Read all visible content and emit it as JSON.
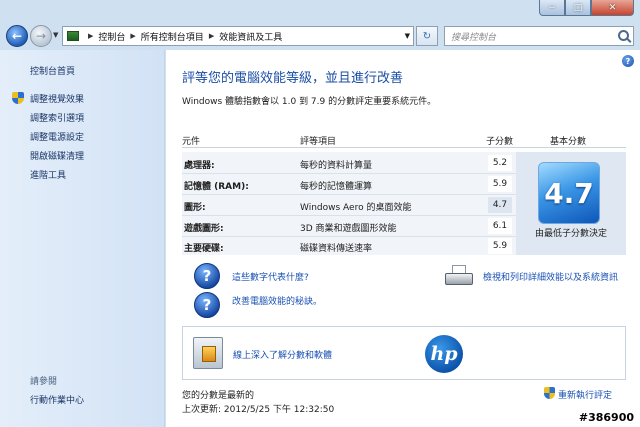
{
  "window": {
    "caption_minimize": "−",
    "caption_maximize": "□",
    "caption_close": "✕"
  },
  "nav": {
    "breadcrumb": [
      "控制台",
      "所有控制台項目",
      "效能資訊及工具"
    ],
    "search_placeholder": "搜尋控制台"
  },
  "sidebar": {
    "home": "控制台首頁",
    "links": [
      "調整視覺效果",
      "調整索引選項",
      "調整電源設定",
      "開啟磁碟清理",
      "進階工具"
    ],
    "see_also_header": "請參閱",
    "see_also": [
      "行動作業中心"
    ]
  },
  "main": {
    "title": "評等您的電腦效能等級，並且進行改善",
    "subtitle": "Windows 體驗指數會以 1.0 到 7.9 的分數評定重要系統元件。",
    "columns": {
      "component": "元件",
      "rated": "評等項目",
      "subscore": "子分數",
      "basescore": "基本分數"
    },
    "rows": [
      {
        "component": "處理器:",
        "desc": "每秒的資料計算量",
        "score": "5.2"
      },
      {
        "component": "記憶體 (RAM):",
        "desc": "每秒的記憶體運算",
        "score": "5.9"
      },
      {
        "component": "圖形:",
        "desc": "Windows Aero 的桌面效能",
        "score": "4.7"
      },
      {
        "component": "遊戲圖形:",
        "desc": "3D 商業和遊戲圖形效能",
        "score": "6.1"
      },
      {
        "component": "主要硬碟:",
        "desc": "磁碟資料傳送速率",
        "score": "5.9"
      }
    ],
    "base_score": "4.7",
    "base_caption": "由最低子分數決定",
    "link_meaning": "這些數字代表什麼?",
    "link_tips": "改善電腦效能的秘訣。",
    "link_print": "檢視和列印詳細效能以及系統資訊",
    "link_learn_more": "線上深入了解分數和軟體",
    "hp_logo": "hp",
    "status_current": "您的分數是最新的",
    "status_last_update": "上次更新: 2012/5/25 下午 12:32:50",
    "rerun": "重新執行評定"
  },
  "watermark": "#386900"
}
